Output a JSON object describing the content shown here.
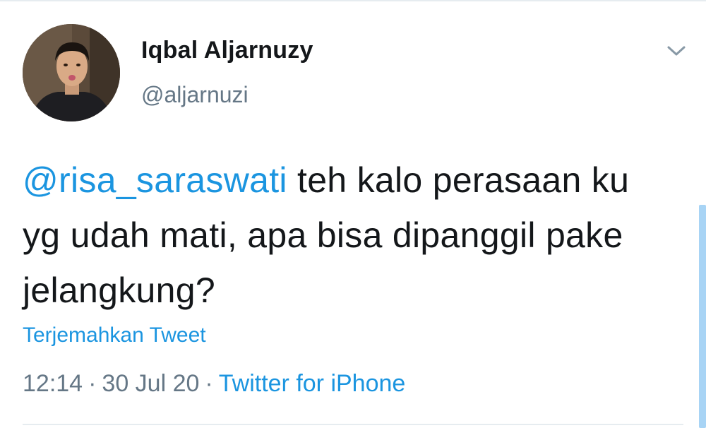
{
  "author": {
    "name": "Iqbal Aljarnuzy",
    "handle": "@aljarnuzi"
  },
  "tweet": {
    "mention": "@risa_saraswati",
    "text": " teh kalo perasaan ku yg udah mati, apa bisa dipanggil pake jelangkung?"
  },
  "translate_label": "Terjemahkan Tweet",
  "meta": {
    "time": "12:14",
    "separator": "·",
    "date": "30 Jul 20",
    "source": "Twitter for iPhone"
  },
  "icons": {
    "menu": "chevron-down-icon"
  },
  "colors": {
    "link": "#1b95e0",
    "text": "#14171a",
    "secondary": "#657786"
  }
}
